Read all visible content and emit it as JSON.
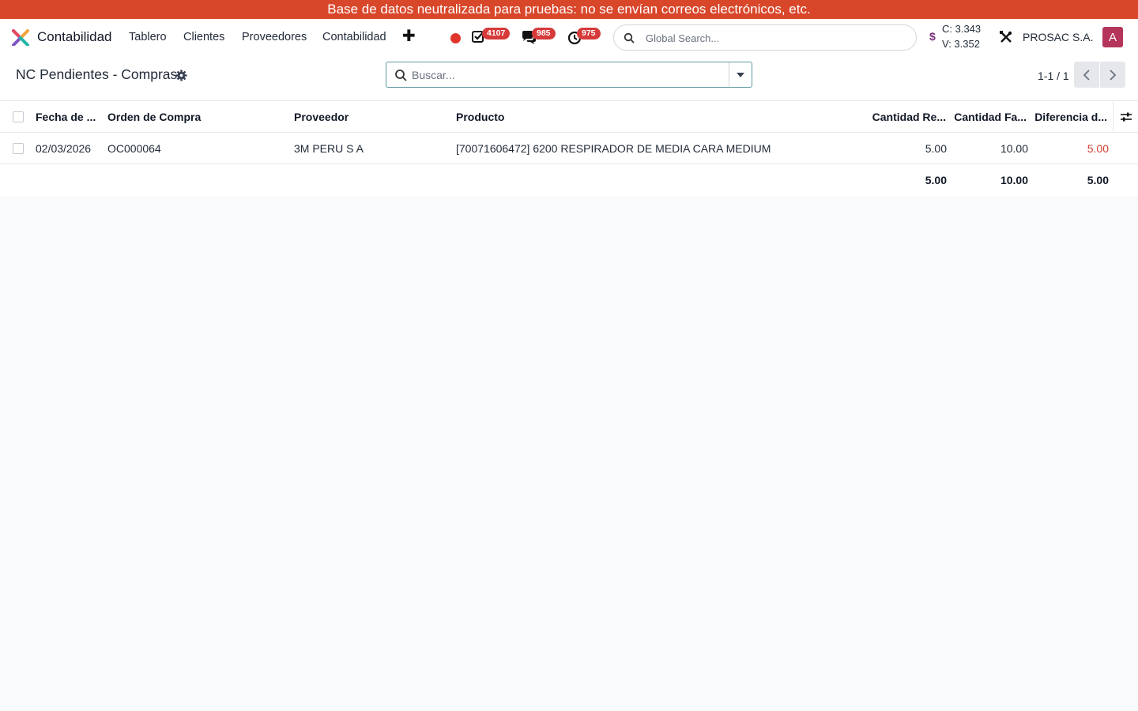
{
  "banner": {
    "text": "Base de datos neutralizada para pruebas: no se envían correos electrónicos, etc."
  },
  "navbar": {
    "app_name": "Contabilidad",
    "menu": [
      "Tablero",
      "Clientes",
      "Proveedores",
      "Contabilidad"
    ],
    "badges": {
      "activities": "4107",
      "messages": "985",
      "timesheets": "975"
    },
    "global_search_placeholder": "Global Search...",
    "rates": {
      "symbol": "$",
      "c": "C: 3.343",
      "v": "V: 3.352"
    },
    "company": "PROSAC S.A.",
    "avatar_initial": "A",
    "colors": {
      "banner": "#d9472b",
      "badge": "#d63a3a",
      "avatar": "#b5345a",
      "record": "#e0352b"
    }
  },
  "control_panel": {
    "title": "NC Pendientes - Compras",
    "search_placeholder": "Buscar...",
    "pager": "1-1 / 1"
  },
  "table": {
    "columns": [
      "Fecha de ...",
      "Orden de Compra",
      "Proveedor",
      "Producto",
      "Cantidad Re...",
      "Cantidad Fa...",
      "Diferencia d..."
    ],
    "rows": [
      {
        "fecha": "02/03/2026",
        "orden": "OC000064",
        "proveedor": "3M PERU S A",
        "producto": "[70071606472] 6200 RESPIRADOR DE MEDIA CARA MEDIUM",
        "cantidad_recibida": "5.00",
        "cantidad_facturada": "10.00",
        "diferencia": "5.00"
      }
    ],
    "totals": {
      "cantidad_recibida": "5.00",
      "cantidad_facturada": "10.00",
      "diferencia": "5.00"
    }
  }
}
